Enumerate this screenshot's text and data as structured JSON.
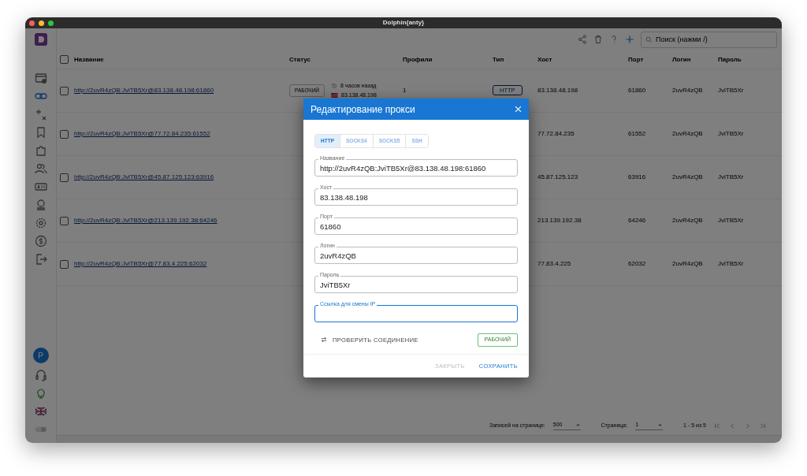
{
  "window": {
    "title": "Dolphin{anty}"
  },
  "sidebar": {
    "avatar_letter": "P",
    "theme_toggle_on": false
  },
  "toolbar": {
    "search": {
      "placeholder": "Поиск (нажми /)"
    }
  },
  "table": {
    "select_all_checked": false,
    "columns": [
      "Название",
      "Статус",
      "Профили",
      "Тип",
      "Хост",
      "Порт",
      "Логин",
      "Пароль"
    ],
    "rows": [
      {
        "checked": false,
        "name": "http://2uvR4zQB:JviTB5Xr@83.138.48.198:61860",
        "status": "РАБОЧИЙ",
        "last_check": "8 часов назад",
        "ip": "83.138.48.198",
        "profiles": "1",
        "type": "HTTP",
        "host": "83.138.48.198",
        "port": "61860",
        "login": "2uvR4zQB",
        "password": "JviTB5Xr"
      },
      {
        "checked": false,
        "name": "http://2uvR4zQB:JviTB5Xr@77.72.84.235:61552",
        "host": "77.72.84.235",
        "port": "61552",
        "login": "2uvR4zQB",
        "password": "JviTB5Xr"
      },
      {
        "checked": false,
        "name": "http://2uvR4zQB:JviTB5Xr@45.87.125.123:63916",
        "host": "45.87.125.123",
        "port": "63916",
        "login": "2uvR4zQB",
        "password": "JviTB5Xr"
      },
      {
        "checked": false,
        "name": "http://2uvR4zQB:JviTB5Xr@213.139.192.38:64246",
        "host": "213.139.192.38",
        "port": "64246",
        "login": "2uvR4zQB",
        "password": "JviTB5Xr"
      },
      {
        "checked": false,
        "name": "http://2uvR4zQB:JviTB5Xr@77.83.4.225:62032",
        "host": "77.83.4.225",
        "port": "62032",
        "login": "2uvR4zQB",
        "password": "JviTB5Xr"
      }
    ]
  },
  "pagination": {
    "per_page_label": "Записей на странице:",
    "per_page": "500",
    "page_label": "Страница:",
    "page": "1",
    "range": "1 - 5 из 5"
  },
  "dialog": {
    "title": "Редактирование прокси",
    "tabs": [
      {
        "label": "HTTP",
        "selected": true
      },
      {
        "label": "SOCKS4",
        "selected": false
      },
      {
        "label": "SOCKS5",
        "selected": false
      },
      {
        "label": "SSH",
        "selected": false
      }
    ],
    "fields": [
      {
        "label": "Название",
        "value": "http://2uvR4zQB:JviTB5Xr@83.138.48.198:61860",
        "focused": false
      },
      {
        "label": "Хост",
        "value": "83.138.48.198",
        "focused": false
      },
      {
        "label": "Порт",
        "value": "61860",
        "focused": false
      },
      {
        "label": "Логин",
        "value": "2uvR4zQB",
        "focused": false
      },
      {
        "label": "Пароль",
        "value": "JviTB5Xr",
        "focused": false
      },
      {
        "label": "Ссылка для смены IP",
        "focused": true
      }
    ],
    "check_button": "ПРОВЕРИТЬ СОЕДИНЕНИЕ",
    "check_result": "РАБОЧИЙ",
    "buttons": [
      {
        "label": "ЗАКРЫТЬ",
        "disabled": true
      },
      {
        "label": "СОХРАНИТЬ",
        "disabled": false
      }
    ]
  }
}
